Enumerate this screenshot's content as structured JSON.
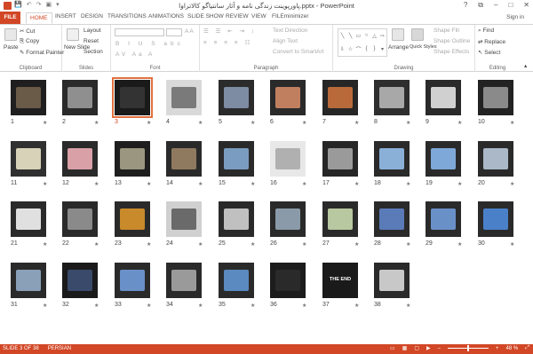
{
  "app": {
    "title": "پاورپوینت زندگی نامه و آثار سانتیاگو کالاتراوا.pptx - PowerPoint",
    "signin": "Sign in",
    "controls": [
      "?",
      "⧉",
      "–",
      "□",
      "✕"
    ]
  },
  "ribbon_tabs": [
    {
      "label": "FILE"
    },
    {
      "label": "HOME"
    },
    {
      "label": "INSERT"
    },
    {
      "label": "DESIGN"
    },
    {
      "label": "TRANSITIONS"
    },
    {
      "label": "ANIMATIONS"
    },
    {
      "label": "SLIDE SHOW"
    },
    {
      "label": "REVIEW"
    },
    {
      "label": "VIEW"
    },
    {
      "label": "FILEminimizer"
    }
  ],
  "ribbon": {
    "clipboard": {
      "label": "Clipboard",
      "paste": "Paste",
      "cut": "Cut",
      "copy": "Copy",
      "format_painter": "Format Painter"
    },
    "slides": {
      "label": "Slides",
      "new_slide": "New Slide",
      "layout": "Layout",
      "reset": "Reset",
      "section": "Section"
    },
    "font": {
      "label": "Font"
    },
    "paragraph": {
      "label": "Paragraph",
      "text_direction": "Text Direction",
      "align_text": "Align Text",
      "convert": "Convert to SmartArt"
    },
    "drawing": {
      "label": "Drawing",
      "arrange": "Arrange",
      "quick_styles": "Quick Styles",
      "shape_fill": "Shape Fill",
      "shape_outline": "Shape Outline",
      "shape_effects": "Shape Effects"
    },
    "editing": {
      "label": "Editing",
      "find": "Find",
      "replace": "Replace",
      "select": "Select"
    }
  },
  "slides": [
    {
      "num": "1",
      "c1": "#1f1f1f",
      "c2": "#6a5a48"
    },
    {
      "num": "2",
      "c1": "#2a2a2a",
      "c2": "#8f8f8f"
    },
    {
      "num": "3",
      "c1": "#1a1a1a",
      "c2": "#333333"
    },
    {
      "num": "4",
      "c1": "#d9d9d9",
      "c2": "#7a7a7a"
    },
    {
      "num": "5",
      "c1": "#2b2b2b",
      "c2": "#7d8ba3"
    },
    {
      "num": "6",
      "c1": "#2a2a2a",
      "c2": "#c08060"
    },
    {
      "num": "7",
      "c1": "#262626",
      "c2": "#b86a3a"
    },
    {
      "num": "8",
      "c1": "#2e2e2e",
      "c2": "#a8a8a8"
    },
    {
      "num": "9",
      "c1": "#2a2a2a",
      "c2": "#d0d0d0"
    },
    {
      "num": "10",
      "c1": "#222222",
      "c2": "#8a8a8a"
    },
    {
      "num": "11",
      "c1": "#303030",
      "c2": "#d8d2b8"
    },
    {
      "num": "12",
      "c1": "#2a2a2a",
      "c2": "#d9a0a8"
    },
    {
      "num": "13",
      "c1": "#1e1e1e",
      "c2": "#9a9680"
    },
    {
      "num": "14",
      "c1": "#2a2a2a",
      "c2": "#8f7a60"
    },
    {
      "num": "15",
      "c1": "#2a2a2a",
      "c2": "#7a9cc0"
    },
    {
      "num": "16",
      "c1": "#e8e8e8",
      "c2": "#b0b0b0"
    },
    {
      "num": "17",
      "c1": "#262626",
      "c2": "#9a9a9a"
    },
    {
      "num": "18",
      "c1": "#2a2a2a",
      "c2": "#8ab0d8"
    },
    {
      "num": "19",
      "c1": "#2a2a2a",
      "c2": "#7ea8d8"
    },
    {
      "num": "20",
      "c1": "#2a2a2a",
      "c2": "#aab8c8"
    },
    {
      "num": "21",
      "c1": "#2a2a2a",
      "c2": "#e0e0e0"
    },
    {
      "num": "22",
      "c1": "#2a2a2a",
      "c2": "#8a8a8a"
    },
    {
      "num": "23",
      "c1": "#2a2a2a",
      "c2": "#c88a2a"
    },
    {
      "num": "24",
      "c1": "#d0d0d0",
      "c2": "#6a6a6a"
    },
    {
      "num": "25",
      "c1": "#2a2a2a",
      "c2": "#c0c0c0"
    },
    {
      "num": "26",
      "c1": "#2a2a2a",
      "c2": "#8a9aa8"
    },
    {
      "num": "27",
      "c1": "#2a2a2a",
      "c2": "#b8c8a0"
    },
    {
      "num": "28",
      "c1": "#2a2a2a",
      "c2": "#5a7ab8"
    },
    {
      "num": "29",
      "c1": "#2a2a2a",
      "c2": "#6a90c8"
    },
    {
      "num": "30",
      "c1": "#2a2a2a",
      "c2": "#4a80c8"
    },
    {
      "num": "31",
      "c1": "#2a2a2a",
      "c2": "#8aa0b8"
    },
    {
      "num": "32",
      "c1": "#1a1a1a",
      "c2": "#3a4a6a"
    },
    {
      "num": "33",
      "c1": "#2a2a2a",
      "c2": "#6a90c8"
    },
    {
      "num": "34",
      "c1": "#2a2a2a",
      "c2": "#9a9a9a"
    },
    {
      "num": "35",
      "c1": "#2a2a2a",
      "c2": "#5a8ac0"
    },
    {
      "num": "36",
      "c1": "#1c1c1c",
      "c2": "#2a2a2a"
    },
    {
      "num": "37",
      "c1": "#1a1a1a",
      "c2": "#1a1a1a",
      "text": "THE END"
    },
    {
      "num": "38",
      "c1": "#2a2a2a",
      "c2": "#c8c8c8"
    }
  ],
  "selected_slide": "3",
  "status": {
    "slide_indicator": "SLIDE 3 OF 38",
    "language": "PERSIAN",
    "zoom": "48 %"
  },
  "colors": {
    "accent": "#d24726",
    "selection": "#e2713f"
  }
}
